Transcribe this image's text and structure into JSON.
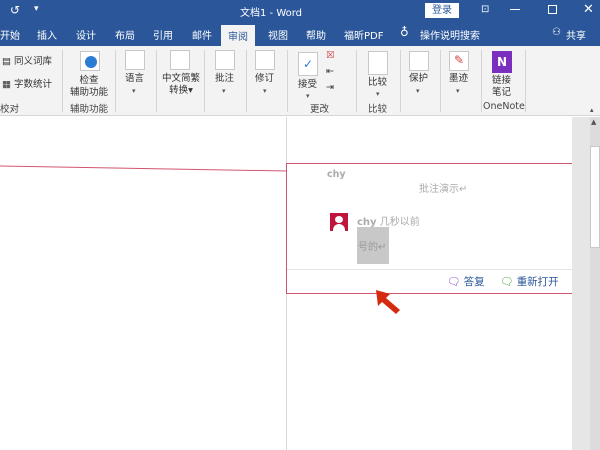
{
  "titlebar": {
    "title": "文档1  -  Word",
    "login": "登录",
    "icons": [
      "undo-icon",
      "customize-qat-icon",
      "ribbon-display-icon",
      "minimize-icon",
      "maximize-icon",
      "close-icon"
    ]
  },
  "tabs": [
    {
      "label": "开始"
    },
    {
      "label": "插入"
    },
    {
      "label": "设计"
    },
    {
      "label": "布局"
    },
    {
      "label": "引用"
    },
    {
      "label": "邮件"
    },
    {
      "label": "审阅",
      "active": true
    },
    {
      "label": "视图"
    },
    {
      "label": "帮助"
    },
    {
      "label": "福昕PDF"
    }
  ],
  "search": {
    "label": "操作说明搜索",
    "icon": "lightbulb-icon"
  },
  "share": {
    "label": "共享",
    "icon": "person-icon"
  },
  "ribbon": {
    "proofing": {
      "thesaurus": "同义词库",
      "wordcount": "字数统计",
      "group": "校对"
    },
    "accessibility": {
      "line1": "检查",
      "line2": "辅助功能",
      "group": "辅助功能"
    },
    "language": {
      "label": "语言"
    },
    "chinese": {
      "line1": "中文简繁",
      "line2": "转换"
    },
    "comments": {
      "label": "批注"
    },
    "tracking": {
      "label": "修订"
    },
    "changes": {
      "accept": "接受",
      "group": "更改"
    },
    "compare": {
      "label": "比较",
      "group": "比较"
    },
    "protect": {
      "label": "保护"
    },
    "ink": {
      "label": "墨迹"
    },
    "onenote": {
      "line1": "链接",
      "line2": "笔记",
      "group": "OneNote"
    }
  },
  "comment": {
    "author": "chy",
    "text": "批注演示↵",
    "reply_author": "chy",
    "reply_time": "几秒以前",
    "reply_text": "号的↵",
    "reply_button": "答复",
    "reopen_button": "重新打开"
  },
  "colors": {
    "accent": "#2b579a",
    "comment_border": "#d0566f",
    "avatar": "#c0143c",
    "onenote": "#7b2fbe"
  }
}
